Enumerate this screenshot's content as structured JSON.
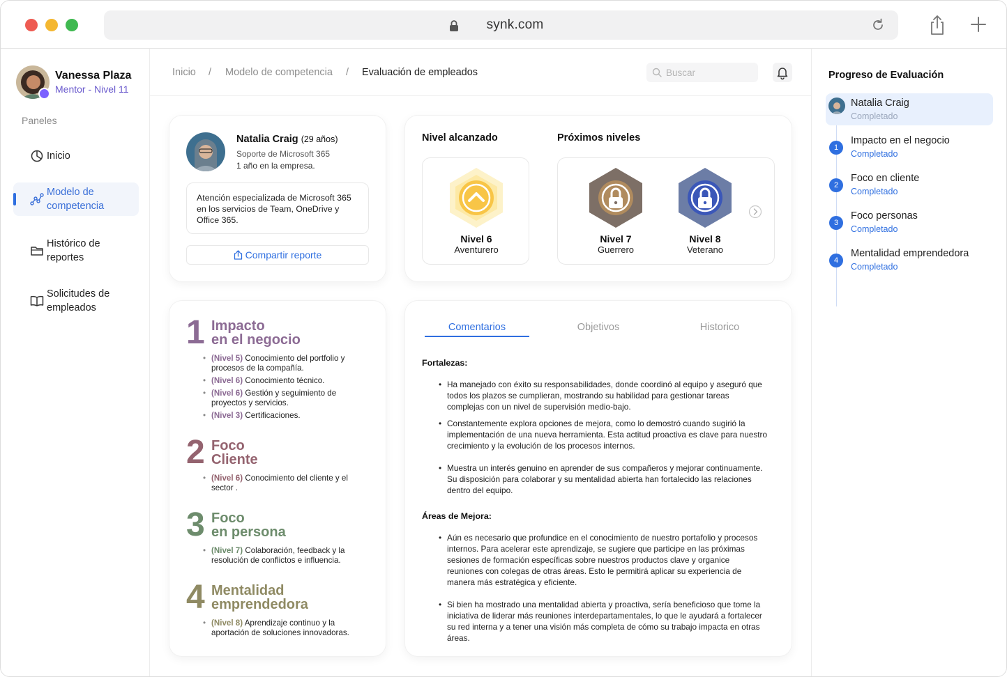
{
  "browser": {
    "url": "synk.com"
  },
  "user": {
    "name": "Vanessa Plaza",
    "role": "Mentor - Nivel 11"
  },
  "sidebar": {
    "section_title": "Paneles",
    "items": [
      {
        "label": "Inicio",
        "icon": "pie-chart-icon"
      },
      {
        "label": "Modelo de competencia",
        "icon": "network-icon",
        "active": true
      },
      {
        "label": "Histórico de reportes",
        "icon": "folder-icon"
      },
      {
        "label": "Solicitudes de empleados",
        "icon": "book-icon"
      }
    ]
  },
  "breadcrumb": {
    "items": [
      "Inicio",
      "Modelo de competencia",
      "Evaluación de empleados"
    ]
  },
  "search": {
    "placeholder": "Buscar"
  },
  "employee": {
    "name": "Natalia Craig",
    "age": "(29 años)",
    "role": "Soporte de Microsoft 365",
    "tenure": "1 año en la empresa.",
    "description": "Atención especializada de Microsoft 365 en los servicios de Team, OneDrive y  Office 365.",
    "share_label": "Compartir reporte"
  },
  "levels": {
    "reached_title": "Nivel alcanzado",
    "next_title": "Próximos niveles",
    "reached": {
      "name": "Nivel 6",
      "sub": "Aventurero",
      "color": "#f8c547"
    },
    "next": [
      {
        "name": "Nivel 7",
        "sub": "Guerrero",
        "color": "#7d6f66"
      },
      {
        "name": "Nivel 8",
        "sub": "Veterano",
        "color": "#6c7da6"
      }
    ]
  },
  "competencies": [
    {
      "num": "1",
      "title_l1": "Impacto",
      "title_l2": "en el negocio",
      "color": "#8c6b94",
      "items": [
        {
          "lvl": "(Nivel 5)",
          "text": "Conocimiento del portfolio y procesos de la compañía."
        },
        {
          "lvl": "(Nivel 6)",
          "text": "Conocimiento técnico."
        },
        {
          "lvl": "(Nivel 6)",
          "text": "Gestión y seguimiento de proyectos y servicios."
        },
        {
          "lvl": "(Nivel 3)",
          "text": "Certificaciones."
        }
      ]
    },
    {
      "num": "2",
      "title_l1": "Foco",
      "title_l2": "Cliente",
      "color": "#94636f",
      "items": [
        {
          "lvl": "(Nivel 6)",
          "text": "Conocimiento del cliente  y el sector ."
        }
      ]
    },
    {
      "num": "3",
      "title_l1": "Foco",
      "title_l2": "en persona",
      "color": "#6d8c6c",
      "items": [
        {
          "lvl": "(Nivel 7)",
          "text": "Colaboración, feedback y la resolución de conflictos e influencia."
        }
      ]
    },
    {
      "num": "4",
      "title_l1": "Mentalidad",
      "title_l2": "emprendedora",
      "color": "#8f8a63",
      "items": [
        {
          "lvl": "(Nivel 8)",
          "text": "Aprendizaje continuo y la aportación de soluciones innovadoras."
        }
      ]
    }
  ],
  "tabs": [
    "Comentarios",
    "Objetivos",
    "Historico"
  ],
  "comments": {
    "strengths_title": "Fortalezas:",
    "strengths": [
      "Ha manejado con éxito su responsabilidades, donde coordinó al equipo y aseguró que todos los plazos se cumplieran, mostrando su habilidad para gestionar tareas complejas con un nivel de supervisión medio-bajo.",
      "Constantemente explora opciones de mejora, como lo demostró cuando sugirió  la implementación de una nueva herramienta.  Esta actitud proactiva es clave para nuestro crecimiento y la evolución de los procesos internos.",
      "Muestra un interés genuino en aprender de sus compañeros y mejorar continuamente. Su disposición para colaborar y su mentalidad abierta han fortalecido las relaciones dentro del equipo."
    ],
    "improve_title": "Áreas de Mejora:",
    "improve": [
      "Aún es necesario que profundice en el conocimiento de nuestro portafolio y procesos internos. Para acelerar este aprendizaje, se sugiere que participe en las próximas sesiones de formación específicas sobre nuestros productos clave y organice reuniones con colegas de otras áreas. Esto le permitirá aplicar su experiencia de manera más estratégica y eficiente.",
      "Si bien ha mostrado una mentalidad abierta y proactiva, sería beneficioso que tome la iniciativa de liderar más reuniones interdepartamentales, lo que le ayudará a fortalecer su red interna y a tener una visión más completa de cómo su trabajo impacta en otras áreas."
    ]
  },
  "progress": {
    "title": "Progreso de Evaluación",
    "steps": [
      {
        "label": "Natalia Craig",
        "status": "Completado"
      },
      {
        "num": "1",
        "label": "Impacto en el negocio",
        "status": "Completado"
      },
      {
        "num": "2",
        "label": "Foco en cliente",
        "status": "Completado"
      },
      {
        "num": "3",
        "label": "Foco personas",
        "status": "Completado"
      },
      {
        "num": "4",
        "label": "Mentalidad emprendedora",
        "status": "Completado"
      }
    ]
  }
}
